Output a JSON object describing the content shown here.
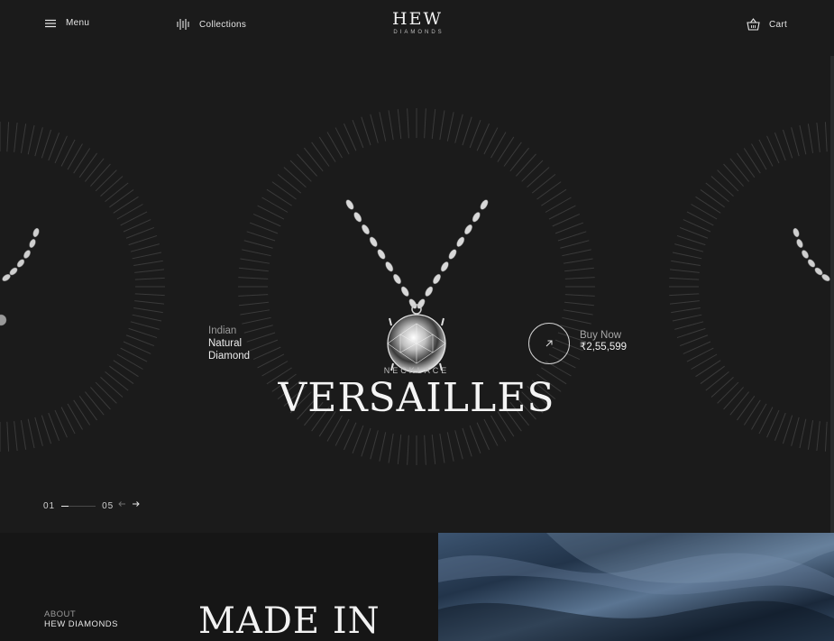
{
  "header": {
    "menu_label": "Menu",
    "collections_label": "Collections",
    "cart_label": "Cart",
    "logo_main": "HEW",
    "logo_sub": "DIAMONDS"
  },
  "hero": {
    "origin_line1": "Indian",
    "origin_line2": "Natural",
    "origin_line3": "Diamond",
    "buy_label": "Buy Now",
    "price": "₹2,55,599",
    "category": "NECKLACE",
    "product_name": "VERSAILLES"
  },
  "slider": {
    "current": "01",
    "total": "05",
    "progress": 0.2,
    "prev_icon": "arrow-left-icon",
    "next_icon": "arrow-right-icon"
  },
  "about": {
    "eyebrow": "ABOUT",
    "brand": "HEW DIAMONDS",
    "heading": "MADE IN"
  },
  "colors": {
    "background": "#1b1b1b",
    "text": "#e9e9e9",
    "satin": "#2c4058"
  }
}
